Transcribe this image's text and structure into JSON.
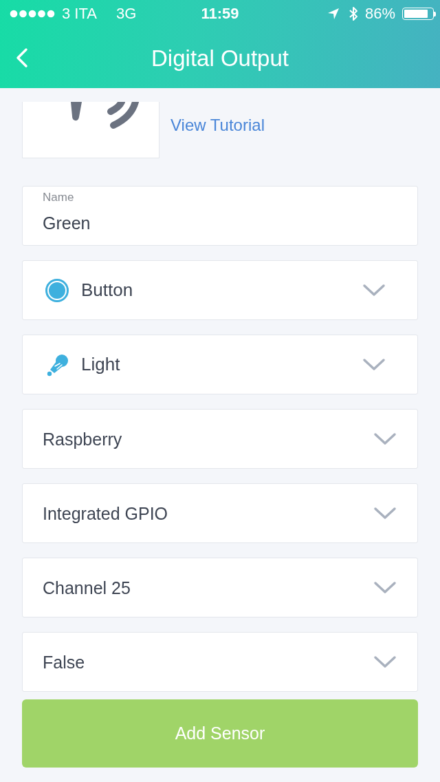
{
  "status_bar": {
    "carrier": "3 ITA",
    "network": "3G",
    "time": "11:59",
    "battery": "86%"
  },
  "nav": {
    "title": "Digital Output"
  },
  "preview": {
    "link": "View Tutorial"
  },
  "name_field": {
    "label": "Name",
    "value": "Green"
  },
  "dropdowns": [
    {
      "kind": "circle",
      "value": "Button"
    },
    {
      "kind": "bulb",
      "value": "Light"
    },
    {
      "kind": "plain",
      "value": "Raspberry"
    },
    {
      "kind": "plain",
      "value": "Integrated GPIO"
    },
    {
      "kind": "plain",
      "value": "Channel 25"
    },
    {
      "kind": "plain",
      "value": "False"
    }
  ],
  "submit": {
    "label": "Add Sensor"
  }
}
